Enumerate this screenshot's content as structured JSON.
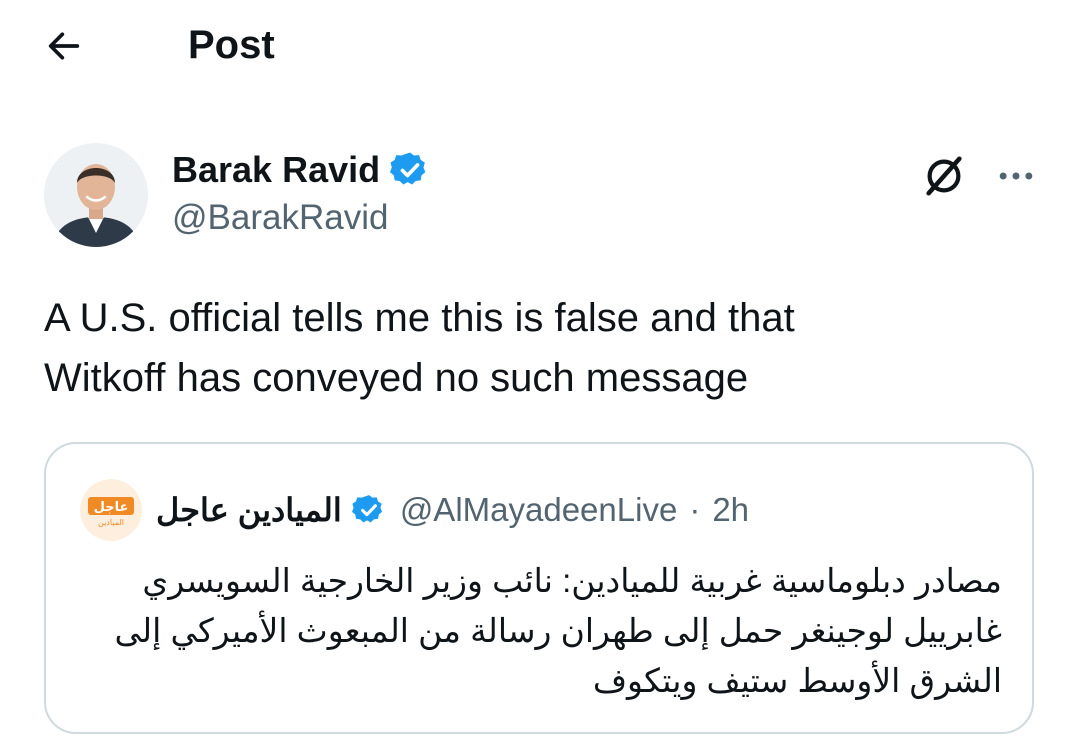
{
  "header": {
    "title": "Post"
  },
  "author": {
    "name": "Barak Ravid",
    "handle": "@BarakRavid"
  },
  "tweet": {
    "text": "A U.S. official tells me this is false and that\nWitkoff has conveyed no such message"
  },
  "quote": {
    "name": "الميادين عاجل",
    "handle": "@AlMayadeenLive",
    "separator": "·",
    "time": "2h",
    "logo_text": "عاجل",
    "logo_subtext": "الميادين",
    "text": "مصادر دبلوماسية غربية للميادين: نائب وزير الخارجية السويسري\nغابرييل لوجينغر حمل إلى طهران رسالة من المبعوث الأميركي إلى\nالشرق الأوسط ستيف ويتكوف"
  },
  "colors": {
    "verified": "#1d9bf0",
    "secondary_text": "#536471",
    "border": "#cfd9de",
    "logo_orange": "#f08a24"
  },
  "icons": [
    "back-arrow-icon",
    "verified-badge-icon",
    "grok-icon",
    "more-icon"
  ]
}
